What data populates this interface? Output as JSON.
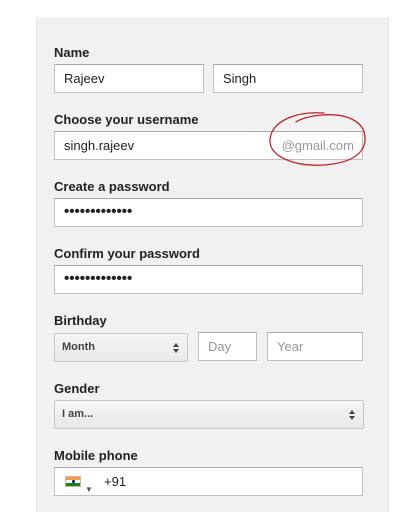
{
  "name": {
    "label": "Name",
    "first_value": "Rajeev",
    "last_value": "Singh"
  },
  "username": {
    "label": "Choose your username",
    "value": "singh.rajeev",
    "suffix": "@gmail.com"
  },
  "password": {
    "label": "Create a password",
    "value": "•••••••••••••"
  },
  "confirm": {
    "label": "Confirm your password",
    "value": "•••••••••••••"
  },
  "birthday": {
    "label": "Birthday",
    "month_selected": "Month",
    "day_placeholder": "Day",
    "year_placeholder": "Year"
  },
  "gender": {
    "label": "Gender",
    "selected": "I am..."
  },
  "mobile": {
    "label": "Mobile phone",
    "country_flag": "india-flag-icon",
    "value": "+91"
  },
  "colors": {
    "annotation_circle": "#c0272d",
    "panel_background": "#f1f1f1"
  }
}
